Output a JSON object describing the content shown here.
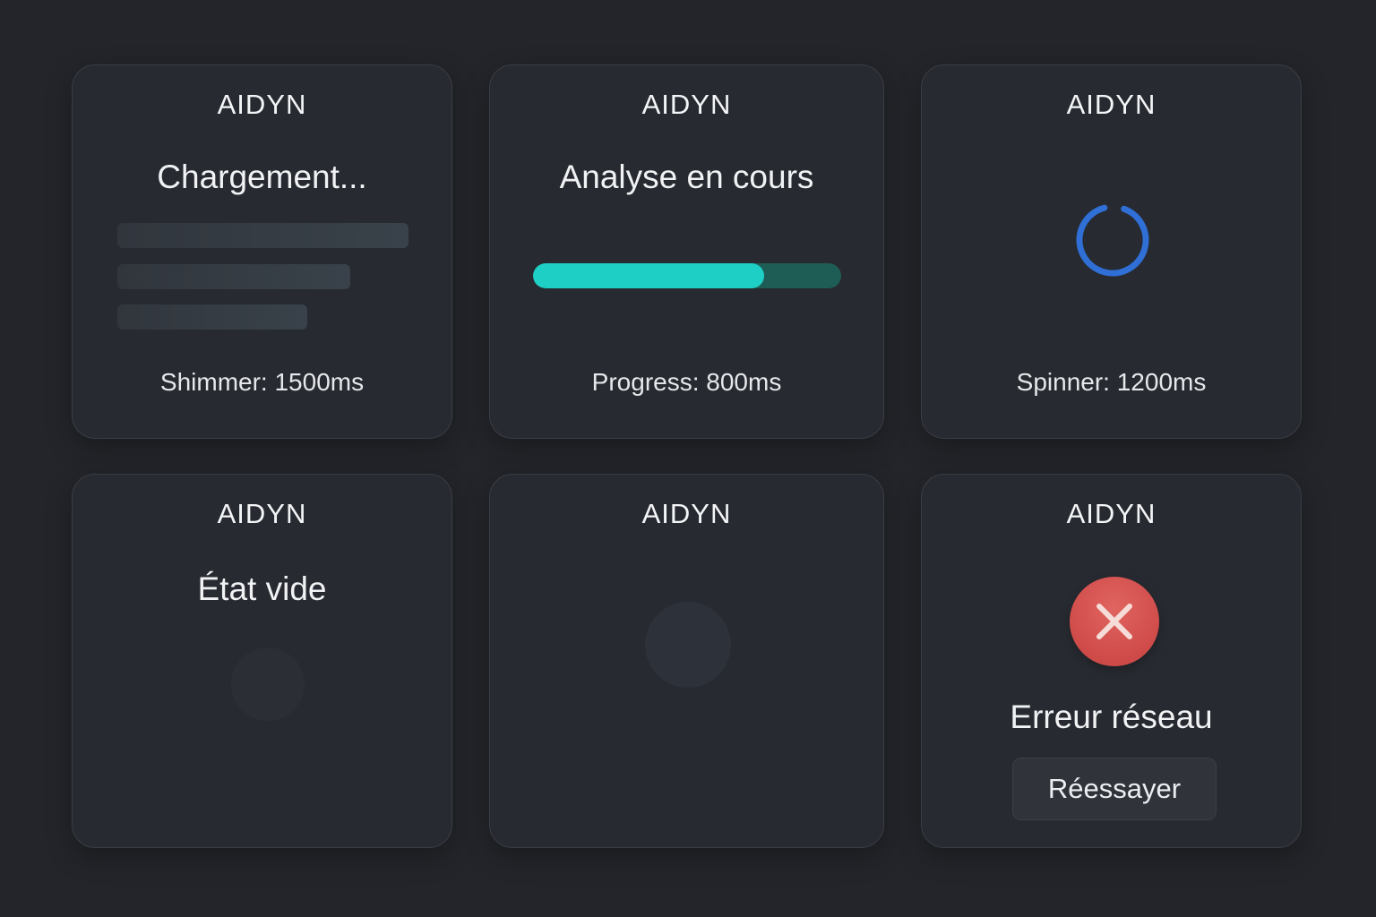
{
  "cards": [
    {
      "brand": "AIDYN",
      "title": "Chargement...",
      "caption": "Shimmer: 1500ms"
    },
    {
      "brand": "AIDYN",
      "title": "Analyse en cours",
      "caption": "Progress: 800ms",
      "progress_fraction": 0.75
    },
    {
      "brand": "AIDYN",
      "caption": "Spinner: 1200ms"
    },
    {
      "brand": "AIDYN",
      "title": "État vide"
    },
    {
      "brand": "AIDYN"
    },
    {
      "brand": "AIDYN",
      "title": "Erreur réseau",
      "button_label": "Réessayer"
    }
  ],
  "icons": {
    "spinner": "loading-spinner-icon",
    "error": "close-x-icon",
    "empty": "empty-state-circle-icon"
  },
  "colors": {
    "background": "#23252a",
    "card": "#272a30",
    "progress_fill": "#1ecfc5",
    "progress_track": "#1e5c56",
    "spinner": "#2f6fd6",
    "error": "#d24f4c"
  }
}
